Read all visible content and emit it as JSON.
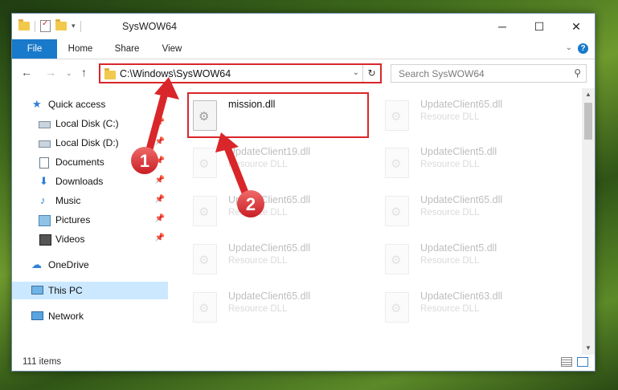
{
  "window": {
    "title": "SysWOW64",
    "controls": {
      "minimize": "─",
      "maximize": "☐",
      "close": "✕"
    }
  },
  "ribbon": {
    "tabs": [
      "File",
      "Home",
      "Share",
      "View"
    ],
    "help": "?",
    "collapse": "⌄"
  },
  "nav": {
    "back": "←",
    "forward": "→",
    "recent": "⌄",
    "up": "↑"
  },
  "address": {
    "path": "C:\\Windows\\SysWOW64",
    "dropdown": "⌄",
    "refresh": "↻"
  },
  "search": {
    "placeholder": "Search SysWOW64",
    "icon": "⚲"
  },
  "sidebar": {
    "items": [
      {
        "label": "Quick access",
        "icon": "star-icon",
        "pinned": false
      },
      {
        "label": "Local Disk (C:)",
        "icon": "drive-icon",
        "pinned": true
      },
      {
        "label": "Local Disk (D:)",
        "icon": "drive-icon",
        "pinned": true
      },
      {
        "label": "Documents",
        "icon": "documents-icon",
        "pinned": true
      },
      {
        "label": "Downloads",
        "icon": "downloads-icon",
        "pinned": true
      },
      {
        "label": "Music",
        "icon": "music-icon",
        "pinned": true
      },
      {
        "label": "Pictures",
        "icon": "pictures-icon",
        "pinned": true
      },
      {
        "label": "Videos",
        "icon": "videos-icon",
        "pinned": true
      },
      {
        "label": "OneDrive",
        "icon": "onedrive-icon",
        "pinned": false
      },
      {
        "label": "This PC",
        "icon": "pc-icon",
        "pinned": false,
        "selected": true
      },
      {
        "label": "Network",
        "icon": "network-icon",
        "pinned": false
      }
    ],
    "pin_glyph": "📌"
  },
  "files": {
    "items": [
      {
        "name": "mission.dll",
        "type": "",
        "highlighted": true
      },
      {
        "name": "UpdateClient65.dll",
        "type": "Resource DLL"
      },
      {
        "name": "UpdateClient19.dll",
        "type": "Resource DLL"
      },
      {
        "name": "UpdateClient5.dll",
        "type": "Resource DLL"
      },
      {
        "name": "UpdateClient65.dll",
        "type": "Resource DLL"
      },
      {
        "name": "UpdateClient65.dll",
        "type": "Resource DLL"
      },
      {
        "name": "UpdateClient65.dll",
        "type": "Resource DLL"
      },
      {
        "name": "UpdateClient5.dll",
        "type": "Resource DLL"
      },
      {
        "name": "UpdateClient65.dll",
        "type": "Resource DLL"
      },
      {
        "name": "UpdateClient63.dll",
        "type": "Resource DLL"
      }
    ]
  },
  "status": {
    "item_count": "111 items"
  },
  "annotations": {
    "step1": "1",
    "step2": "2",
    "color": "#e0383a"
  },
  "colors": {
    "accent": "#1979ca",
    "selection": "#cce8ff",
    "highlight_border": "#d9262a"
  }
}
